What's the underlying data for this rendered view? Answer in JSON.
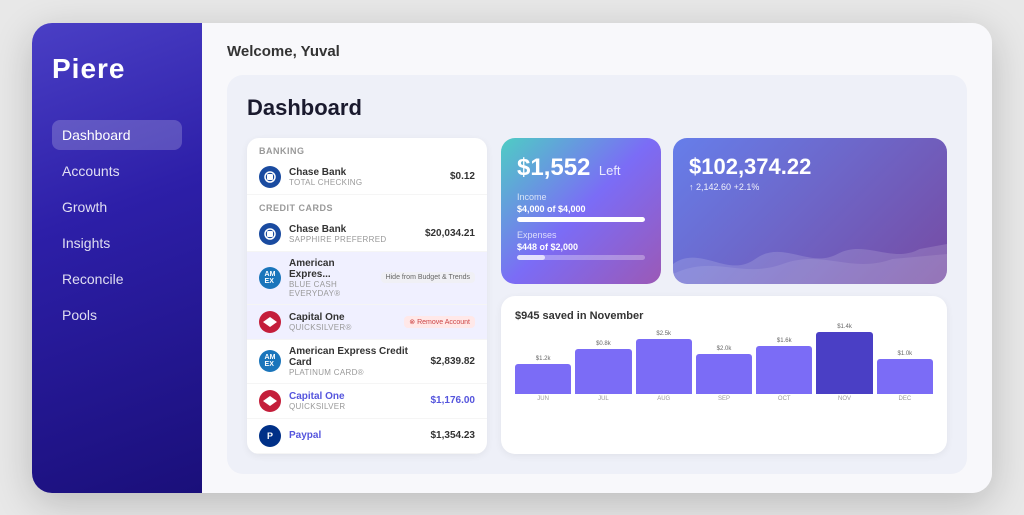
{
  "app": {
    "name": "Piere"
  },
  "header": {
    "welcome": "Welcome, Yuval"
  },
  "sidebar": {
    "items": [
      {
        "label": "Dashboard",
        "active": true
      },
      {
        "label": "Accounts"
      },
      {
        "label": "Growth"
      },
      {
        "label": "Insights"
      },
      {
        "label": "Reconcile"
      },
      {
        "label": "Pools"
      }
    ]
  },
  "dashboard": {
    "title": "Dashboard",
    "banking_label": "Banking",
    "credit_cards_label": "Credit Cards",
    "accounts": [
      {
        "name": "Chase Bank",
        "sub": "TOTAL CHECKING",
        "amount": "$0.12",
        "icon_type": "chase",
        "icon_text": "●"
      },
      {
        "name": "Chase Bank",
        "sub": "SAPPHIRE PREFERRED",
        "amount": "$20,034.21",
        "icon_type": "chase",
        "icon_text": "●"
      },
      {
        "name": "American Expres...",
        "sub": "Blue Cash Everyday®",
        "amount": "",
        "icon_type": "amex",
        "icon_text": "AX",
        "actions": [
          "Hide from Budget & Trends"
        ]
      },
      {
        "name": "Capital One",
        "sub": "Quicksilver®",
        "amount": "",
        "icon_type": "capital",
        "icon_text": "▶",
        "actions": [
          "Remove Account"
        ]
      },
      {
        "name": "American Express Credit Card",
        "sub": "Platinum Card®",
        "amount": "$2,839.82",
        "icon_type": "amex",
        "icon_text": "AX"
      },
      {
        "name": "Capital One",
        "sub": "Quicksilver",
        "amount": "$1,176.00",
        "icon_type": "capital",
        "icon_text": "▶"
      },
      {
        "name": "Paypal",
        "sub": "",
        "amount": "$1,354.23",
        "icon_type": "paypal",
        "icon_text": "P"
      }
    ],
    "budget_card": {
      "amount": "$1,552",
      "label": "Left",
      "income_label": "Income",
      "income_value": "$4,000 of $4,000",
      "income_pct": 100,
      "expenses_label": "Expenses",
      "expenses_value": "$448 of $2,000",
      "expenses_pct": 22
    },
    "networth_card": {
      "amount": "$102,374.22",
      "change_abs": "2,142.60",
      "change_pct": "+2.1%"
    },
    "savings_card": {
      "title": "$945 saved in November",
      "bars": [
        {
          "month": "JUN",
          "value": 30,
          "label": "$1.2k"
        },
        {
          "month": "JUL",
          "value": 55,
          "label": "$0.8k"
        },
        {
          "month": "AUG",
          "value": 65,
          "label": "$2.5k"
        },
        {
          "month": "SEP",
          "value": 45,
          "label": "$2.0k"
        },
        {
          "month": "OCT",
          "value": 50,
          "label": "$1.6k"
        },
        {
          "month": "NOV",
          "value": 75,
          "label": "$1.4k",
          "highlight": true
        },
        {
          "month": "DEC",
          "value": 40,
          "label": "$1.0k"
        }
      ]
    }
  }
}
